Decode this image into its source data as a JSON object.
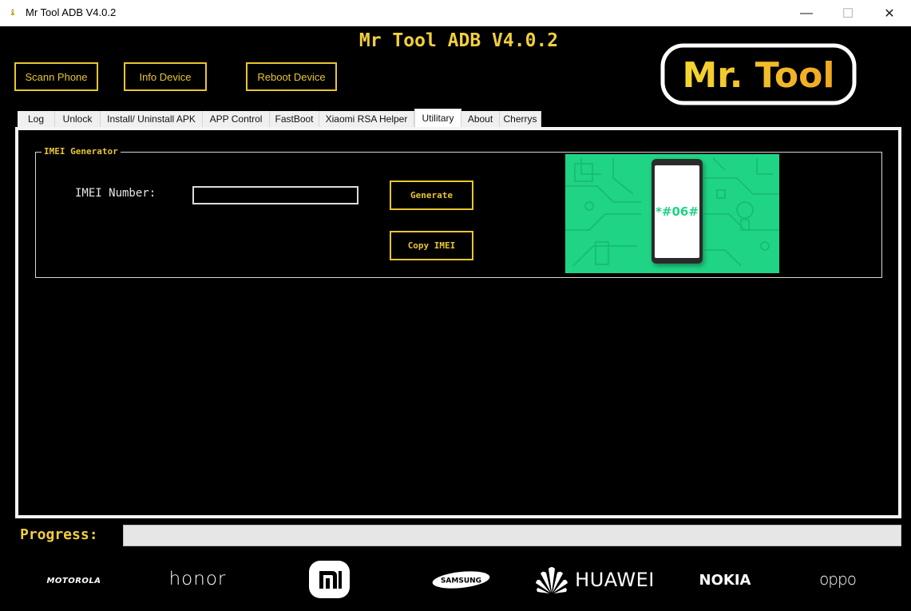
{
  "window": {
    "title": "Mr Tool ADB V4.0.2",
    "controls": {
      "minimize": "—",
      "maximize": "☐",
      "close": "✕"
    }
  },
  "header": {
    "title": "Mr Tool ADB V4.0.2",
    "logo_text": "Mr. Tool",
    "buttons": {
      "scan_phone": "Scann Phone",
      "info_device": "Info Device",
      "reboot_device": "Reboot Device"
    }
  },
  "tabs": [
    {
      "label": "Log",
      "active": false
    },
    {
      "label": "Unlock",
      "active": false
    },
    {
      "label": "Install/ Uninstall APK",
      "active": false
    },
    {
      "label": "APP Control",
      "active": false
    },
    {
      "label": "FastBoot",
      "active": false
    },
    {
      "label": "Xiaomi RSA Helper",
      "active": false
    },
    {
      "label": "Utilitary",
      "active": true
    },
    {
      "label": "About",
      "active": false
    },
    {
      "label": "Cherrys",
      "active": false
    }
  ],
  "imei_generator": {
    "group_label": "IMEI Generator",
    "field_label": "IMEI Number:",
    "field_value": "",
    "generate_label": "Generate",
    "copy_label": "Copy IMEI",
    "image_text": "*#06#"
  },
  "progress": {
    "label": "Progress:",
    "value_percent": 0
  },
  "brands": {
    "motorola": "MOTOROLA",
    "honor": "honor",
    "xiaomi": "mi",
    "samsung": "SAMSUNG",
    "huawei": "HUAWEI",
    "nokia": "NOKIA",
    "oppo": "oppo"
  },
  "colors": {
    "accent": "#e9c52e",
    "background": "#000000",
    "image_green": "#1fd484"
  }
}
